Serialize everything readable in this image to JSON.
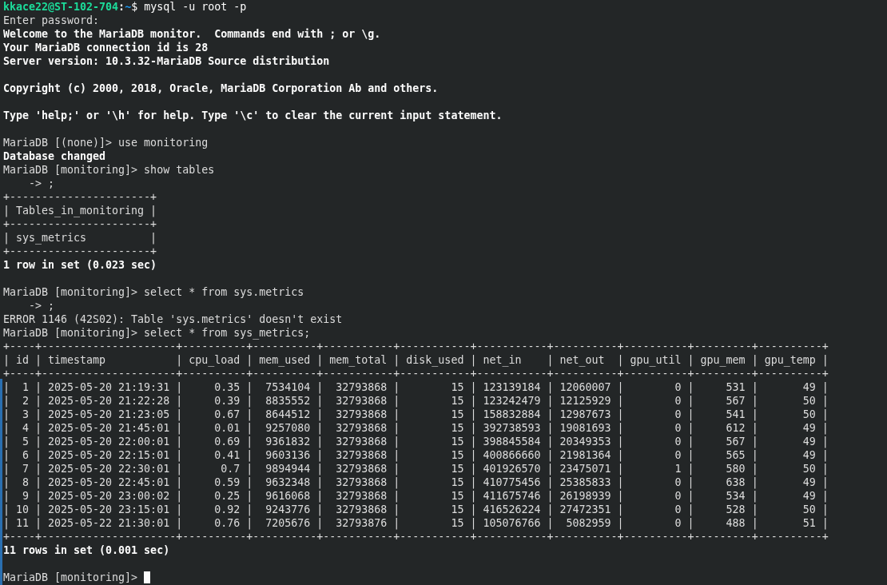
{
  "terminal": {
    "lines": [
      {
        "kind": "shell_prompt",
        "user_host": "kkace22@ST-102-704",
        "separator": ":",
        "path": "~",
        "symbol": "$",
        "command": " mysql -u root -p"
      },
      {
        "kind": "plain",
        "text": "Enter password:"
      },
      {
        "kind": "bold",
        "text": "Welcome to the MariaDB monitor.  Commands end with ; or \\g."
      },
      {
        "kind": "bold",
        "text": "Your MariaDB connection id is 28"
      },
      {
        "kind": "bold",
        "text": "Server version: 10.3.32-MariaDB Source distribution"
      },
      {
        "kind": "blank"
      },
      {
        "kind": "bold",
        "text": "Copyright (c) 2000, 2018, Oracle, MariaDB Corporation Ab and others."
      },
      {
        "kind": "blank"
      },
      {
        "kind": "bold",
        "text": "Type 'help;' or '\\h' for help. Type '\\c' to clear the current input statement."
      },
      {
        "kind": "blank"
      },
      {
        "kind": "plain",
        "text": "MariaDB [(none)]> use monitoring"
      },
      {
        "kind": "bold",
        "text": "Database changed"
      },
      {
        "kind": "plain",
        "text": "MariaDB [monitoring]> show tables"
      },
      {
        "kind": "plain",
        "text": "    -> ;"
      },
      {
        "kind": "plain",
        "text": "+----------------------+"
      },
      {
        "kind": "plain",
        "text": "| Tables_in_monitoring |"
      },
      {
        "kind": "plain",
        "text": "+----------------------+"
      },
      {
        "kind": "plain",
        "text": "| sys_metrics          |"
      },
      {
        "kind": "plain",
        "text": "+----------------------+"
      },
      {
        "kind": "bold",
        "text": "1 row in set (0.023 sec)"
      },
      {
        "kind": "blank"
      },
      {
        "kind": "plain",
        "text": "MariaDB [monitoring]> select * from sys.metrics"
      },
      {
        "kind": "plain",
        "text": "    -> ;"
      },
      {
        "kind": "plain",
        "text": "ERROR 1146 (42S02): Table 'sys.metrics' doesn't exist"
      },
      {
        "kind": "plain",
        "text": "MariaDB [monitoring]> select * from sys_metrics;"
      },
      {
        "kind": "plain",
        "text": "+----+---------------------+----------+----------+-----------+-----------+-----------+----------+----------+---------+----------+"
      },
      {
        "kind": "plain",
        "text": "| id | timestamp           | cpu_load | mem_used | mem_total | disk_used | net_in    | net_out  | gpu_util | gpu_mem | gpu_temp |"
      },
      {
        "kind": "plain",
        "text": "+----+---------------------+----------+----------+-----------+-----------+-----------+----------+----------+---------+----------+"
      },
      {
        "kind": "plain",
        "text": "|  1 | 2025-05-20 21:19:31 |     0.35 |  7534104 |  32793868 |        15 | 123139184 | 12060007 |        0 |     531 |       49 |"
      },
      {
        "kind": "plain",
        "text": "|  2 | 2025-05-20 21:22:28 |     0.39 |  8835552 |  32793868 |        15 | 123242479 | 12125929 |        0 |     567 |       50 |"
      },
      {
        "kind": "plain",
        "text": "|  3 | 2025-05-20 21:23:05 |     0.67 |  8644512 |  32793868 |        15 | 158832884 | 12987673 |        0 |     541 |       50 |"
      },
      {
        "kind": "plain",
        "text": "|  4 | 2025-05-20 21:45:01 |     0.01 |  9257080 |  32793868 |        15 | 392738593 | 19081693 |        0 |     612 |       49 |"
      },
      {
        "kind": "plain",
        "text": "|  5 | 2025-05-20 22:00:01 |     0.69 |  9361832 |  32793868 |        15 | 398845584 | 20349353 |        0 |     567 |       49 |"
      },
      {
        "kind": "plain",
        "text": "|  6 | 2025-05-20 22:15:01 |     0.41 |  9603136 |  32793868 |        15 | 400866660 | 21981364 |        0 |     565 |       49 |"
      },
      {
        "kind": "plain",
        "text": "|  7 | 2025-05-20 22:30:01 |      0.7 |  9894944 |  32793868 |        15 | 401926570 | 23475071 |        1 |     580 |       50 |"
      },
      {
        "kind": "plain",
        "text": "|  8 | 2025-05-20 22:45:01 |     0.59 |  9632348 |  32793868 |        15 | 410775456 | 25385833 |        0 |     638 |       49 |"
      },
      {
        "kind": "plain",
        "text": "|  9 | 2025-05-20 23:00:02 |     0.25 |  9616068 |  32793868 |        15 | 411675746 | 26198939 |        0 |     534 |       49 |"
      },
      {
        "kind": "plain",
        "text": "| 10 | 2025-05-20 23:15:01 |     0.92 |  9243776 |  32793868 |        15 | 416526224 | 27472351 |        0 |     528 |       50 |"
      },
      {
        "kind": "plain",
        "text": "| 11 | 2025-05-22 21:30:01 |     0.76 |  7205676 |  32793876 |        15 | 105076766 |  5082959 |        0 |     488 |       51 |"
      },
      {
        "kind": "plain",
        "text": "+----+---------------------+----------+----------+-----------+-----------+-----------+----------+----------+---------+----------+"
      },
      {
        "kind": "bold",
        "text": "11 rows in set (0.001 sec)"
      },
      {
        "kind": "blank"
      },
      {
        "kind": "input_prompt",
        "text": "MariaDB [monitoring]> ",
        "cursor": true
      }
    ]
  }
}
